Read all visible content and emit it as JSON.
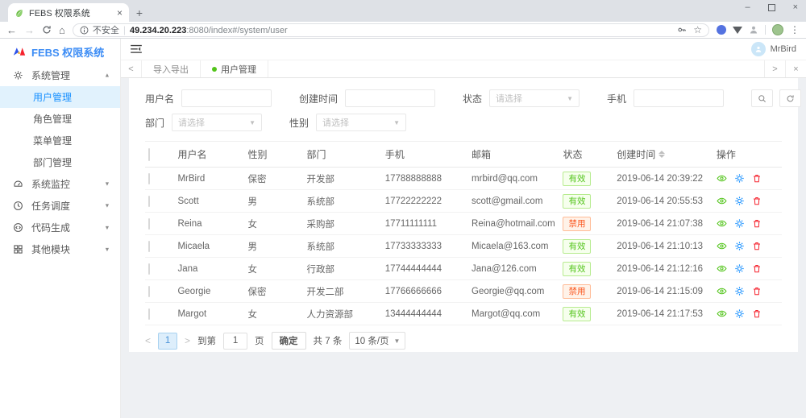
{
  "browser": {
    "tab_title": "FEBS 权限系统",
    "glyphs": {
      "close": "×",
      "plus": "+",
      "minimize": "–",
      "back": "←",
      "forward": "→",
      "home": "⌂",
      "star": "☆",
      "menu_dots": "⋮"
    },
    "security_label": "不安全",
    "url_host": "49.234.20.223",
    "url_path": ":8080/index#/system/user"
  },
  "app": {
    "logo_text": "FEBS 权限系统",
    "user_name": "MrBird",
    "sidebar": [
      {
        "id": "system-manage",
        "label": "系统管理",
        "icon": "gear",
        "expanded": true,
        "children": [
          {
            "label": "用户管理",
            "active": true
          },
          {
            "label": "角色管理",
            "active": false
          },
          {
            "label": "菜单管理",
            "active": false
          },
          {
            "label": "部门管理",
            "active": false
          }
        ]
      },
      {
        "id": "system-monitor",
        "label": "系统监控",
        "icon": "gauge",
        "expanded": false
      },
      {
        "id": "task-schedule",
        "label": "任务调度",
        "icon": "clock",
        "expanded": false
      },
      {
        "id": "code-generate",
        "label": "代码生成",
        "icon": "code",
        "expanded": false
      },
      {
        "id": "other-modules",
        "label": "其他模块",
        "icon": "grid",
        "expanded": false
      }
    ],
    "page_tabs": [
      {
        "label": "导入导出",
        "active": false
      },
      {
        "label": "用户管理",
        "active": true
      }
    ],
    "tabbar_glyphs": {
      "left": "<",
      "right": ">",
      "close": "×"
    },
    "filters": {
      "row1": [
        {
          "id": "username",
          "label": "用户名",
          "type": "input",
          "value": ""
        },
        {
          "id": "create-time",
          "label": "创建时间",
          "type": "input",
          "value": ""
        },
        {
          "id": "status",
          "label": "状态",
          "type": "select",
          "placeholder": "请选择"
        },
        {
          "id": "phone",
          "label": "手机",
          "type": "input",
          "value": ""
        }
      ],
      "row2": [
        {
          "id": "dept",
          "label": "部门",
          "type": "select",
          "placeholder": "请选择"
        },
        {
          "id": "gender",
          "label": "性别",
          "type": "select",
          "placeholder": "请选择"
        }
      ]
    },
    "table": {
      "columns": [
        "用户名",
        "性别",
        "部门",
        "手机",
        "邮箱",
        "状态",
        "创建时间",
        "操作"
      ],
      "sortable_column": "创建时间",
      "rows": [
        {
          "username": "MrBird",
          "gender": "保密",
          "dept": "开发部",
          "phone": "17788888888",
          "email": "mrbird@qq.com",
          "status": "有效",
          "status_type": "valid",
          "created": "2019-06-14 20:39:22"
        },
        {
          "username": "Scott",
          "gender": "男",
          "dept": "系统部",
          "phone": "17722222222",
          "email": "scott@gmail.com",
          "status": "有效",
          "status_type": "valid",
          "created": "2019-06-14 20:55:53"
        },
        {
          "username": "Reina",
          "gender": "女",
          "dept": "采购部",
          "phone": "17711111111",
          "email": "Reina@hotmail.com",
          "status": "禁用",
          "status_type": "disabled",
          "created": "2019-06-14 21:07:38"
        },
        {
          "username": "Micaela",
          "gender": "男",
          "dept": "系统部",
          "phone": "17733333333",
          "email": "Micaela@163.com",
          "status": "有效",
          "status_type": "valid",
          "created": "2019-06-14 21:10:13"
        },
        {
          "username": "Jana",
          "gender": "女",
          "dept": "行政部",
          "phone": "17744444444",
          "email": "Jana@126.com",
          "status": "有效",
          "status_type": "valid",
          "created": "2019-06-14 21:12:16"
        },
        {
          "username": "Georgie",
          "gender": "保密",
          "dept": "开发二部",
          "phone": "17766666666",
          "email": "Georgie@qq.com",
          "status": "禁用",
          "status_type": "disabled",
          "created": "2019-06-14 21:15:09"
        },
        {
          "username": "Margot",
          "gender": "女",
          "dept": "人力资源部",
          "phone": "13444444444",
          "email": "Margot@qq.com",
          "status": "有效",
          "status_type": "valid",
          "created": "2019-06-14 21:17:53"
        }
      ]
    },
    "pagination": {
      "prev": "<",
      "next": ">",
      "current_page": "1",
      "goto_label": "到第",
      "goto_value": "1",
      "page_label": "页",
      "confirm_label": "确定",
      "total_label": "共 7 条",
      "page_size": "10 条/页"
    }
  },
  "colors": {
    "accent_blue": "#1890ff",
    "logo_blue": "#3d8df5",
    "green": "#52c41a",
    "badge_valid_text": "#52c41a",
    "badge_valid_bg": "#f6ffed",
    "badge_valid_border": "#b7eb8f",
    "badge_disabled_text": "#fa541c",
    "badge_disabled_bg": "#fff2e8",
    "badge_disabled_border": "#ffbb96",
    "action_view": "#52c41a",
    "action_edit": "#1890ff",
    "action_delete": "#f5222d"
  }
}
